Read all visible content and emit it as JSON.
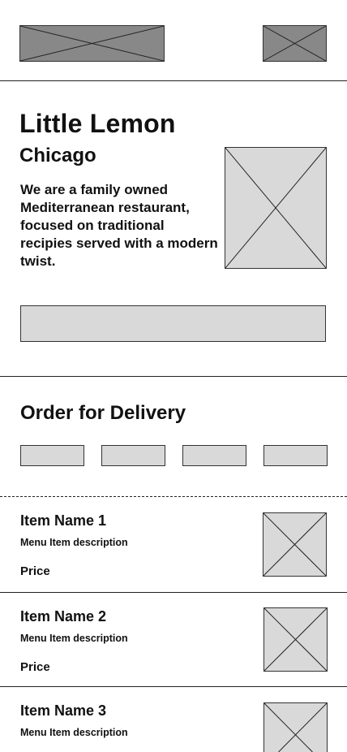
{
  "header": {
    "logo_icon": "image-placeholder-icon",
    "menu_icon": "image-placeholder-icon"
  },
  "hero": {
    "title": "Little Lemon",
    "subtitle": "Chicago",
    "description": "We are a family owned Mediterranean restaurant, focused on traditional recipies served with a modern twist.",
    "image_icon": "image-placeholder-icon"
  },
  "order": {
    "heading": "Order for Delivery"
  },
  "menu": {
    "items": [
      {
        "name": "Item Name 1",
        "description": "Menu Item description",
        "price": "Price"
      },
      {
        "name": "Item Name 2",
        "description": "Menu Item description",
        "price": "Price"
      },
      {
        "name": "Item Name 3",
        "description": "Menu Item description",
        "price": ""
      }
    ]
  },
  "colors": {
    "placeholder_dark": "#888888",
    "placeholder_light": "#d9d9d9",
    "text": "#111111"
  }
}
